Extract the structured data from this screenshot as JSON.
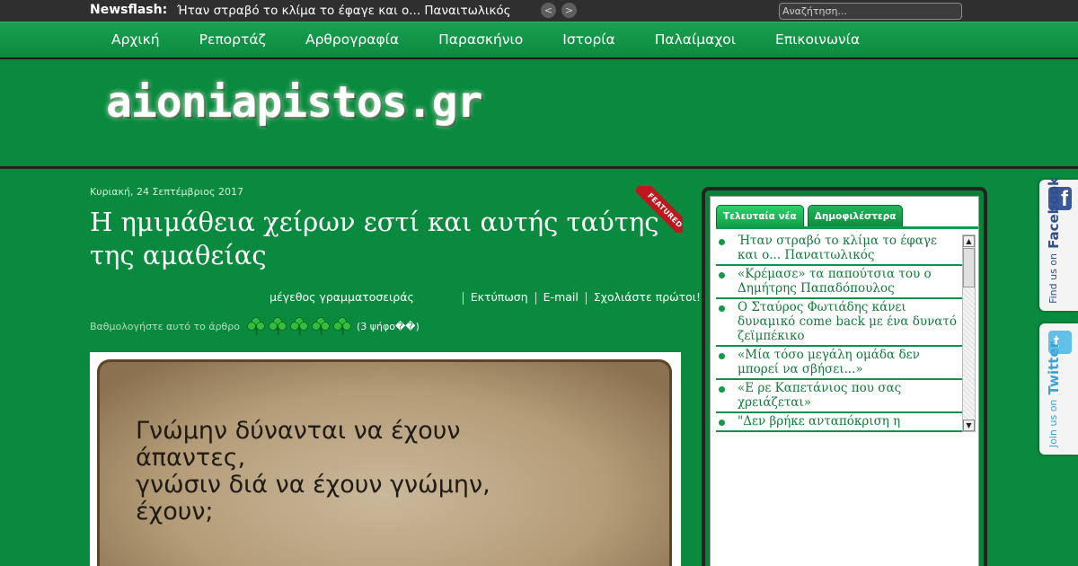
{
  "topbar": {
    "newsflash_label": "Newsflash:",
    "newsflash_text": "Ήταν στραβό το κλίμα το έφαγε και ο... Παναιτωλικός",
    "prev_glyph": "<",
    "next_glyph": ">",
    "search_placeholder": "Αναζήτηση..."
  },
  "nav": {
    "items": [
      {
        "label": "Αρχική"
      },
      {
        "label": "Ρεπορτάζ"
      },
      {
        "label": "Αρθρογραφία"
      },
      {
        "label": "Παρασκήνιο"
      },
      {
        "label": "Ιστορία"
      },
      {
        "label": "Παλαίμαχοι"
      },
      {
        "label": "Επικοινωνία"
      }
    ]
  },
  "header": {
    "logo_text": "aioniapistos.gr"
  },
  "article": {
    "date": "Κυριακή, 24 Σεπτέμβριος 2017",
    "featured_label": "FEATURED",
    "title": "Η ημιμάθεια χείρων εστί και αυτής ταύτης της αμαθείας",
    "tools": {
      "font_size": "μέγεθος γραμματοσειράς",
      "print": "Εκτύπωση",
      "email": "E-mail",
      "comment": "Σχολιάστε πρώτοι!"
    },
    "rating": {
      "label": "Βαθμολογήστε αυτό το άρθρο",
      "stars_total": 5,
      "votes": "(3 ψήφο��)"
    },
    "image_quote": [
      "Γνώμην δύνανται να έχουν",
      "άπαντες,",
      "γνώσιν διά να έχουν γνώμην,",
      "έχουν;"
    ]
  },
  "sidebar": {
    "tabs": [
      {
        "label": "Τελευταία νέα"
      },
      {
        "label": "Δημοφιλέστερα"
      }
    ],
    "news": [
      {
        "title": "Ήταν στραβό το κλίμα το έφαγε και ο... Παναιτωλικός"
      },
      {
        "title": "«Κρέμασε» τα παπούτσια του ο Δημήτρης Παπαδόπουλος"
      },
      {
        "title": "Ο Σταύρος Φωτιάδης κάνει δυναμικό come back με ένα δυνατό ζεϊμπέκικο"
      },
      {
        "title": "«Μία τόσο μεγάλη ομάδα δεν μπορεί να σβήσει...»"
      },
      {
        "title": "«Ε ρε Καπετάνιος που σας χρειάζεται»"
      },
      {
        "title": "\"Δεν βρήκε ανταπόκριση η"
      }
    ]
  },
  "social": {
    "facebook": {
      "small": "Find us on",
      "big": "Facebook",
      "glyph": "f"
    },
    "twitter": {
      "small": "Join us on",
      "big": "Twitter",
      "glyph": "t"
    }
  },
  "colors": {
    "background": "#0a8a3e",
    "topbar": "#2f2f2f",
    "accent": "#129a48",
    "featured_ribbon": "#c0161d"
  }
}
